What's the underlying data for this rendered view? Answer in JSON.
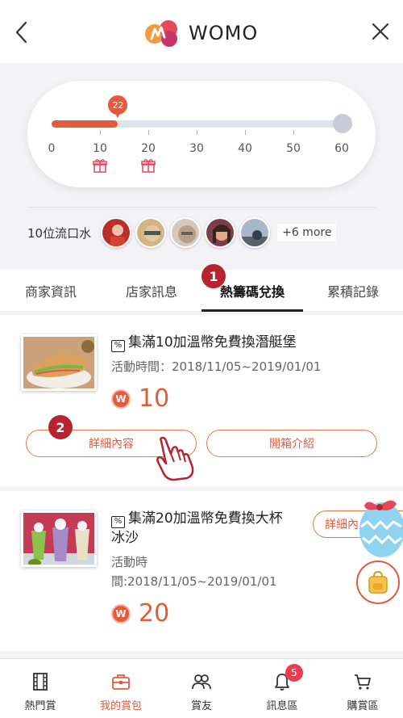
{
  "header": {
    "title": "WOMO"
  },
  "progress": {
    "current_value": "22",
    "current_fraction": 0.229,
    "ticks": [
      "0",
      "10",
      "20",
      "30",
      "40",
      "50",
      "60"
    ],
    "gift_ticks": [
      "10",
      "20"
    ]
  },
  "followers": {
    "label": "10位流口水",
    "more": "+6 more",
    "avatars": [
      "avatar-1",
      "avatar-2",
      "avatar-3",
      "avatar-4",
      "avatar-5"
    ]
  },
  "tabs": [
    {
      "label": "商家資訊"
    },
    {
      "label": "店家訊息"
    },
    {
      "label": "熱籌碼兌換",
      "active": true
    },
    {
      "label": "累積記錄"
    }
  ],
  "steps": {
    "one": "1",
    "two": "2"
  },
  "cards": [
    {
      "title": "集滿10加溫幣免費換潛艇堡",
      "time_label": "活動時間：2018/11/05~2019/01/01",
      "points": "10",
      "coin_letter": "W",
      "buttons": {
        "detail": "詳細內容",
        "unbox": "開箱介紹"
      }
    },
    {
      "title_line1": "集滿20加溫幣免費換大杯",
      "title_line2": "冰沙",
      "time_line1": "活動時",
      "time_line2": "間:2018/11/05~2019/01/01",
      "points": "20",
      "coin_letter": "W",
      "buttons": {
        "detail": "詳細內"
      }
    }
  ],
  "bottom_nav": [
    {
      "label": "熱門賞",
      "icon": "film-icon"
    },
    {
      "label": "我的賞包",
      "icon": "briefcase-icon",
      "active": true
    },
    {
      "label": "賞友",
      "icon": "friends-icon"
    },
    {
      "label": "訊息區",
      "icon": "bell-icon",
      "badge": "5"
    },
    {
      "label": "購賞區",
      "icon": "cart-icon"
    }
  ],
  "colors": {
    "accent": "#e35b3d",
    "step_badge": "#b8232f",
    "notif": "#ef3b4c"
  }
}
